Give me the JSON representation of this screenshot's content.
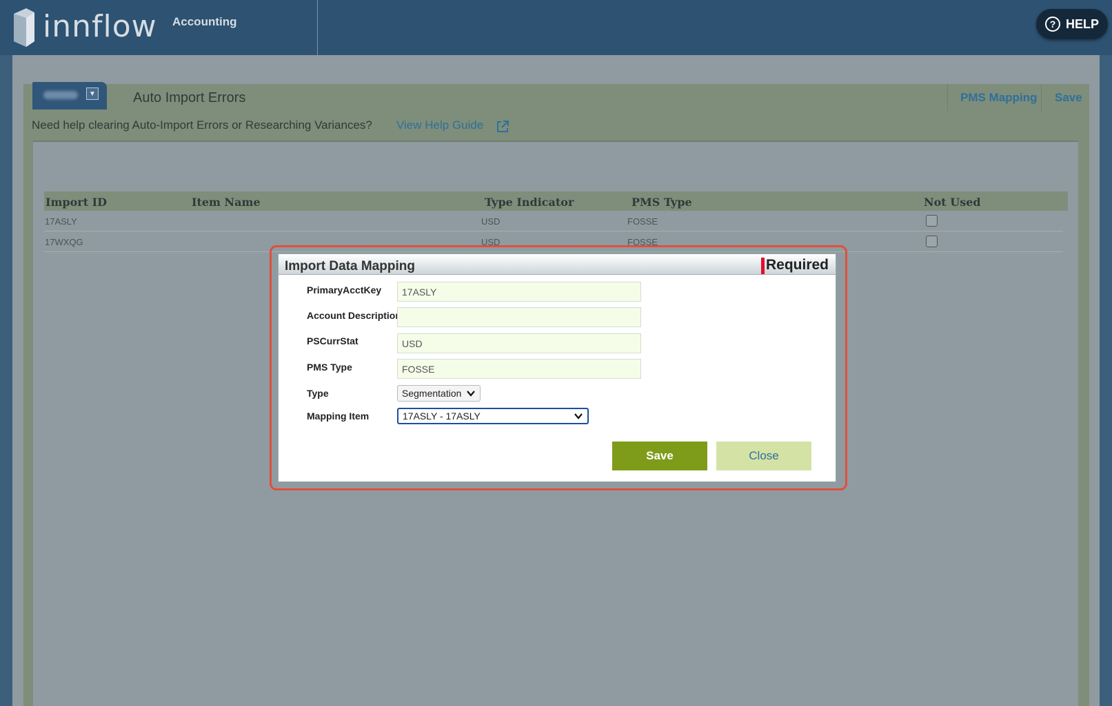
{
  "header": {
    "logo_text": "innflow",
    "module_label": "Accounting",
    "help_label": "HELP"
  },
  "toolbar": {
    "title": "Auto Import Errors",
    "pms_mapping_label": "PMS Mapping",
    "save_label": "Save"
  },
  "help_banner": {
    "text": "Need help clearing Auto-Import Errors or Researching Variances?",
    "link_label": "View Help Guide"
  },
  "table": {
    "columns": [
      "Import ID",
      "Item Name",
      "Type Indicator",
      "PMS Type",
      "Not Used"
    ],
    "rows": [
      {
        "import_id": "17ASLY",
        "item_name": "",
        "type_indicator": "USD",
        "pms_type": "FOSSE",
        "not_used": false
      },
      {
        "import_id": "17WXQG",
        "item_name": "",
        "type_indicator": "USD",
        "pms_type": "FOSSE",
        "not_used": false
      }
    ]
  },
  "modal": {
    "title": "Import Data Mapping",
    "required_label": "Required",
    "fields": {
      "primary_acct_key": {
        "label": "PrimaryAcctKey",
        "value": "17ASLY"
      },
      "account_description": {
        "label": "Account Description",
        "value": ""
      },
      "ps_curr_stat": {
        "label": "PSCurrStat",
        "value": "USD"
      },
      "pms_type": {
        "label": "PMS Type",
        "value": "FOSSE"
      },
      "type": {
        "label": "Type",
        "value": "Segmentation"
      },
      "mapping_item": {
        "label": "Mapping Item",
        "value": "17ASLY - 17ASLY"
      }
    },
    "save_label": "Save",
    "close_label": "Close"
  },
  "colors": {
    "header_bg": "#2d5272",
    "panel_bg": "#7e8e7a",
    "link": "#2f6f9b",
    "save_button": "#7e9c1a",
    "close_button": "#d4e2a6",
    "required_marker": "#e0102a",
    "highlight_outline": "#e0503c"
  }
}
